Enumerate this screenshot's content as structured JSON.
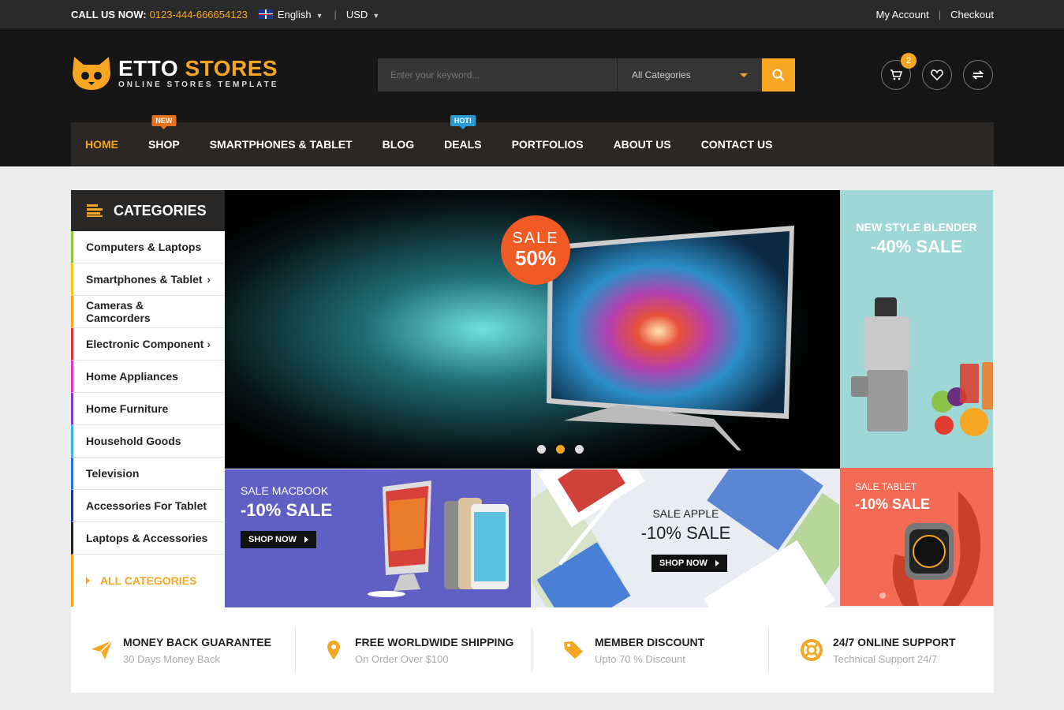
{
  "topbar": {
    "call_label": "CALL US NOW:",
    "phone": "0123-444-666654123",
    "language": "English",
    "currency": "USD",
    "my_account": "My Account",
    "checkout": "Checkout"
  },
  "logo": {
    "title_white": "ETTO",
    "title_yellow": "STORES",
    "subtitle": "ONLINE STORES TEMPLATE"
  },
  "search": {
    "placeholder": "Enter your keyword...",
    "category": "All Categories"
  },
  "cart": {
    "count": "2"
  },
  "nav": {
    "items": [
      {
        "label": "HOME"
      },
      {
        "label": "SHOP",
        "tag": "NEW"
      },
      {
        "label": "SMARTPHONES & TABLET"
      },
      {
        "label": "BLOG"
      },
      {
        "label": "DEALS",
        "tag": "HOT!"
      },
      {
        "label": "PORTFOLIOS"
      },
      {
        "label": "ABOUT US"
      },
      {
        "label": "CONTACT US"
      }
    ]
  },
  "categories": {
    "title": "CATEGORIES",
    "items": [
      {
        "label": "Computers & Laptops",
        "color": "#8dc63f"
      },
      {
        "label": "Smartphones & Tablet",
        "color": "#f5c518"
      },
      {
        "label": "Cameras & Camcorders",
        "color": "#f5a623"
      },
      {
        "label": "Electronic Component",
        "color": "#e0303b"
      },
      {
        "label": "Home Appliances",
        "color": "#d63ec8"
      },
      {
        "label": "Home Furniture",
        "color": "#7b3fc4"
      },
      {
        "label": "Household Goods",
        "color": "#3fb6d6"
      },
      {
        "label": "Television",
        "color": "#2f6ed6"
      },
      {
        "label": "Accessories For Tablet",
        "color": "#1f3b8a"
      },
      {
        "label": "Laptops & Accessories",
        "color": "#222222"
      }
    ],
    "all": "ALL CATEGORIES"
  },
  "slider": {
    "sale_word": "SALE",
    "sale_pct": "50%"
  },
  "banners": {
    "side": {
      "line1": "NEW STYLE BLENDER",
      "line2": "-40% SALE"
    },
    "mac": {
      "line1": "SALE MACBOOK",
      "line2": "-10% SALE",
      "button": "SHOP NOW"
    },
    "apple": {
      "line1": "SALE APPLE",
      "line2": "-10% SALE",
      "button": "SHOP NOW"
    },
    "tablet": {
      "line1": "SALE TABLET",
      "line2": "-10% SALE"
    }
  },
  "features": [
    {
      "title": "MONEY BACK GUARANTEE",
      "sub": "30 Days Money Back",
      "icon": "paper-plane-icon"
    },
    {
      "title": "FREE WORLDWIDE SHIPPING",
      "sub": "On Order Over $100",
      "icon": "map-pin-icon"
    },
    {
      "title": "MEMBER DISCOUNT",
      "sub": "Upto 70 % Discount",
      "icon": "tag-icon"
    },
    {
      "title": "24/7 ONLINE SUPPORT",
      "sub": "Technical Support 24/7",
      "icon": "lifebuoy-icon"
    }
  ],
  "colors": {
    "accent": "#f5a623",
    "dark": "#161616"
  }
}
